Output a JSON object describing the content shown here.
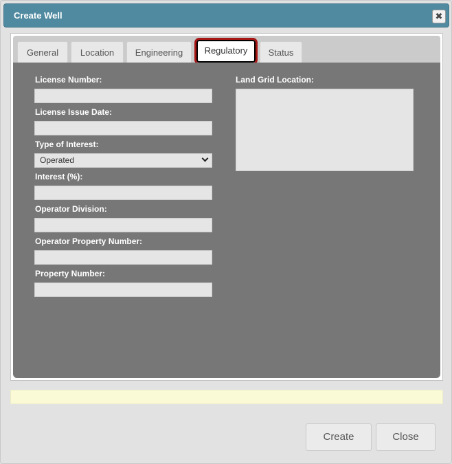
{
  "dialog": {
    "title": "Create Well",
    "close_glyph": "✖"
  },
  "tabs": [
    {
      "label": "General"
    },
    {
      "label": "Location"
    },
    {
      "label": "Engineering"
    },
    {
      "label": "Regulatory"
    },
    {
      "label": "Status"
    }
  ],
  "active_tab": "Regulatory",
  "form": {
    "license_number": {
      "label": "License Number:",
      "value": ""
    },
    "license_issue_date": {
      "label": "License Issue Date:",
      "value": ""
    },
    "type_of_interest": {
      "label": "Type of Interest:",
      "value": "Operated"
    },
    "interest_pct": {
      "label": "Interest (%):",
      "value": ""
    },
    "operator_division": {
      "label": "Operator Division:",
      "value": ""
    },
    "operator_property_number": {
      "label": "Operator Property Number:",
      "value": ""
    },
    "property_number": {
      "label": "Property Number:",
      "value": ""
    },
    "land_grid_location": {
      "label": "Land Grid Location:",
      "value": ""
    }
  },
  "buttons": {
    "create": "Create",
    "close": "Close"
  },
  "colors": {
    "titlebar": "#4f8aa1",
    "content_bg": "#777777",
    "active_tab_outline": "#a71414",
    "status_bar": "#fbfad6"
  }
}
